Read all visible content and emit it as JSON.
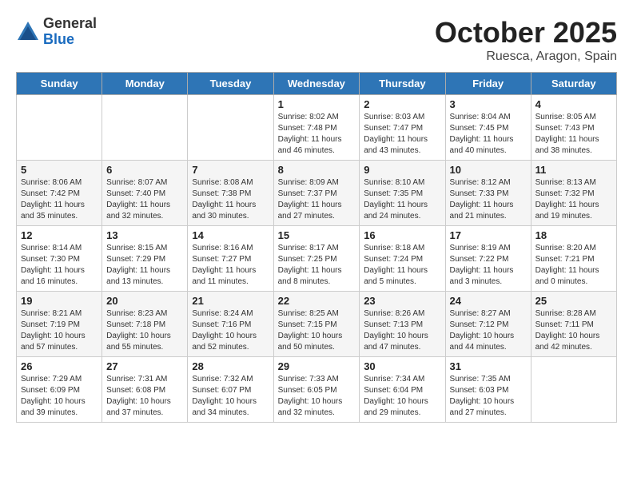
{
  "logo": {
    "general": "General",
    "blue": "Blue"
  },
  "title": "October 2025",
  "location": "Ruesca, Aragon, Spain",
  "days_of_week": [
    "Sunday",
    "Monday",
    "Tuesday",
    "Wednesday",
    "Thursday",
    "Friday",
    "Saturday"
  ],
  "weeks": [
    [
      {
        "day": "",
        "info": ""
      },
      {
        "day": "",
        "info": ""
      },
      {
        "day": "",
        "info": ""
      },
      {
        "day": "1",
        "info": "Sunrise: 8:02 AM\nSunset: 7:48 PM\nDaylight: 11 hours\nand 46 minutes."
      },
      {
        "day": "2",
        "info": "Sunrise: 8:03 AM\nSunset: 7:47 PM\nDaylight: 11 hours\nand 43 minutes."
      },
      {
        "day": "3",
        "info": "Sunrise: 8:04 AM\nSunset: 7:45 PM\nDaylight: 11 hours\nand 40 minutes."
      },
      {
        "day": "4",
        "info": "Sunrise: 8:05 AM\nSunset: 7:43 PM\nDaylight: 11 hours\nand 38 minutes."
      }
    ],
    [
      {
        "day": "5",
        "info": "Sunrise: 8:06 AM\nSunset: 7:42 PM\nDaylight: 11 hours\nand 35 minutes."
      },
      {
        "day": "6",
        "info": "Sunrise: 8:07 AM\nSunset: 7:40 PM\nDaylight: 11 hours\nand 32 minutes."
      },
      {
        "day": "7",
        "info": "Sunrise: 8:08 AM\nSunset: 7:38 PM\nDaylight: 11 hours\nand 30 minutes."
      },
      {
        "day": "8",
        "info": "Sunrise: 8:09 AM\nSunset: 7:37 PM\nDaylight: 11 hours\nand 27 minutes."
      },
      {
        "day": "9",
        "info": "Sunrise: 8:10 AM\nSunset: 7:35 PM\nDaylight: 11 hours\nand 24 minutes."
      },
      {
        "day": "10",
        "info": "Sunrise: 8:12 AM\nSunset: 7:33 PM\nDaylight: 11 hours\nand 21 minutes."
      },
      {
        "day": "11",
        "info": "Sunrise: 8:13 AM\nSunset: 7:32 PM\nDaylight: 11 hours\nand 19 minutes."
      }
    ],
    [
      {
        "day": "12",
        "info": "Sunrise: 8:14 AM\nSunset: 7:30 PM\nDaylight: 11 hours\nand 16 minutes."
      },
      {
        "day": "13",
        "info": "Sunrise: 8:15 AM\nSunset: 7:29 PM\nDaylight: 11 hours\nand 13 minutes."
      },
      {
        "day": "14",
        "info": "Sunrise: 8:16 AM\nSunset: 7:27 PM\nDaylight: 11 hours\nand 11 minutes."
      },
      {
        "day": "15",
        "info": "Sunrise: 8:17 AM\nSunset: 7:25 PM\nDaylight: 11 hours\nand 8 minutes."
      },
      {
        "day": "16",
        "info": "Sunrise: 8:18 AM\nSunset: 7:24 PM\nDaylight: 11 hours\nand 5 minutes."
      },
      {
        "day": "17",
        "info": "Sunrise: 8:19 AM\nSunset: 7:22 PM\nDaylight: 11 hours\nand 3 minutes."
      },
      {
        "day": "18",
        "info": "Sunrise: 8:20 AM\nSunset: 7:21 PM\nDaylight: 11 hours\nand 0 minutes."
      }
    ],
    [
      {
        "day": "19",
        "info": "Sunrise: 8:21 AM\nSunset: 7:19 PM\nDaylight: 10 hours\nand 57 minutes."
      },
      {
        "day": "20",
        "info": "Sunrise: 8:23 AM\nSunset: 7:18 PM\nDaylight: 10 hours\nand 55 minutes."
      },
      {
        "day": "21",
        "info": "Sunrise: 8:24 AM\nSunset: 7:16 PM\nDaylight: 10 hours\nand 52 minutes."
      },
      {
        "day": "22",
        "info": "Sunrise: 8:25 AM\nSunset: 7:15 PM\nDaylight: 10 hours\nand 50 minutes."
      },
      {
        "day": "23",
        "info": "Sunrise: 8:26 AM\nSunset: 7:13 PM\nDaylight: 10 hours\nand 47 minutes."
      },
      {
        "day": "24",
        "info": "Sunrise: 8:27 AM\nSunset: 7:12 PM\nDaylight: 10 hours\nand 44 minutes."
      },
      {
        "day": "25",
        "info": "Sunrise: 8:28 AM\nSunset: 7:11 PM\nDaylight: 10 hours\nand 42 minutes."
      }
    ],
    [
      {
        "day": "26",
        "info": "Sunrise: 7:29 AM\nSunset: 6:09 PM\nDaylight: 10 hours\nand 39 minutes."
      },
      {
        "day": "27",
        "info": "Sunrise: 7:31 AM\nSunset: 6:08 PM\nDaylight: 10 hours\nand 37 minutes."
      },
      {
        "day": "28",
        "info": "Sunrise: 7:32 AM\nSunset: 6:07 PM\nDaylight: 10 hours\nand 34 minutes."
      },
      {
        "day": "29",
        "info": "Sunrise: 7:33 AM\nSunset: 6:05 PM\nDaylight: 10 hours\nand 32 minutes."
      },
      {
        "day": "30",
        "info": "Sunrise: 7:34 AM\nSunset: 6:04 PM\nDaylight: 10 hours\nand 29 minutes."
      },
      {
        "day": "31",
        "info": "Sunrise: 7:35 AM\nSunset: 6:03 PM\nDaylight: 10 hours\nand 27 minutes."
      },
      {
        "day": "",
        "info": ""
      }
    ]
  ]
}
